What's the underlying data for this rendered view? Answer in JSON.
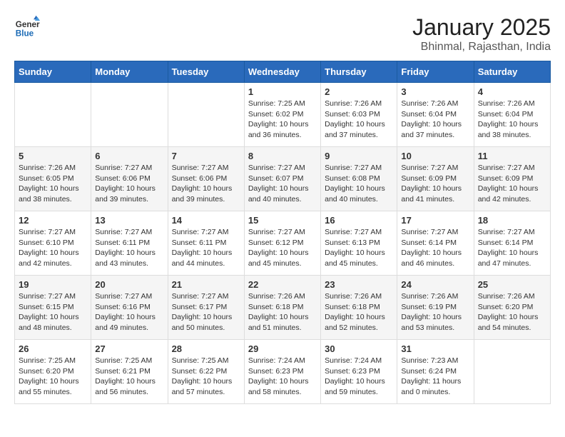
{
  "header": {
    "logo_line1": "General",
    "logo_line2": "Blue",
    "month_title": "January 2025",
    "location": "Bhinmal, Rajasthan, India"
  },
  "weekdays": [
    "Sunday",
    "Monday",
    "Tuesday",
    "Wednesday",
    "Thursday",
    "Friday",
    "Saturday"
  ],
  "weeks": [
    [
      {
        "day": "",
        "info": ""
      },
      {
        "day": "",
        "info": ""
      },
      {
        "day": "",
        "info": ""
      },
      {
        "day": "1",
        "info": "Sunrise: 7:25 AM\nSunset: 6:02 PM\nDaylight: 10 hours and 36 minutes."
      },
      {
        "day": "2",
        "info": "Sunrise: 7:26 AM\nSunset: 6:03 PM\nDaylight: 10 hours and 37 minutes."
      },
      {
        "day": "3",
        "info": "Sunrise: 7:26 AM\nSunset: 6:04 PM\nDaylight: 10 hours and 37 minutes."
      },
      {
        "day": "4",
        "info": "Sunrise: 7:26 AM\nSunset: 6:04 PM\nDaylight: 10 hours and 38 minutes."
      }
    ],
    [
      {
        "day": "5",
        "info": "Sunrise: 7:26 AM\nSunset: 6:05 PM\nDaylight: 10 hours and 38 minutes."
      },
      {
        "day": "6",
        "info": "Sunrise: 7:27 AM\nSunset: 6:06 PM\nDaylight: 10 hours and 39 minutes."
      },
      {
        "day": "7",
        "info": "Sunrise: 7:27 AM\nSunset: 6:06 PM\nDaylight: 10 hours and 39 minutes."
      },
      {
        "day": "8",
        "info": "Sunrise: 7:27 AM\nSunset: 6:07 PM\nDaylight: 10 hours and 40 minutes."
      },
      {
        "day": "9",
        "info": "Sunrise: 7:27 AM\nSunset: 6:08 PM\nDaylight: 10 hours and 40 minutes."
      },
      {
        "day": "10",
        "info": "Sunrise: 7:27 AM\nSunset: 6:09 PM\nDaylight: 10 hours and 41 minutes."
      },
      {
        "day": "11",
        "info": "Sunrise: 7:27 AM\nSunset: 6:09 PM\nDaylight: 10 hours and 42 minutes."
      }
    ],
    [
      {
        "day": "12",
        "info": "Sunrise: 7:27 AM\nSunset: 6:10 PM\nDaylight: 10 hours and 42 minutes."
      },
      {
        "day": "13",
        "info": "Sunrise: 7:27 AM\nSunset: 6:11 PM\nDaylight: 10 hours and 43 minutes."
      },
      {
        "day": "14",
        "info": "Sunrise: 7:27 AM\nSunset: 6:11 PM\nDaylight: 10 hours and 44 minutes."
      },
      {
        "day": "15",
        "info": "Sunrise: 7:27 AM\nSunset: 6:12 PM\nDaylight: 10 hours and 45 minutes."
      },
      {
        "day": "16",
        "info": "Sunrise: 7:27 AM\nSunset: 6:13 PM\nDaylight: 10 hours and 45 minutes."
      },
      {
        "day": "17",
        "info": "Sunrise: 7:27 AM\nSunset: 6:14 PM\nDaylight: 10 hours and 46 minutes."
      },
      {
        "day": "18",
        "info": "Sunrise: 7:27 AM\nSunset: 6:14 PM\nDaylight: 10 hours and 47 minutes."
      }
    ],
    [
      {
        "day": "19",
        "info": "Sunrise: 7:27 AM\nSunset: 6:15 PM\nDaylight: 10 hours and 48 minutes."
      },
      {
        "day": "20",
        "info": "Sunrise: 7:27 AM\nSunset: 6:16 PM\nDaylight: 10 hours and 49 minutes."
      },
      {
        "day": "21",
        "info": "Sunrise: 7:27 AM\nSunset: 6:17 PM\nDaylight: 10 hours and 50 minutes."
      },
      {
        "day": "22",
        "info": "Sunrise: 7:26 AM\nSunset: 6:18 PM\nDaylight: 10 hours and 51 minutes."
      },
      {
        "day": "23",
        "info": "Sunrise: 7:26 AM\nSunset: 6:18 PM\nDaylight: 10 hours and 52 minutes."
      },
      {
        "day": "24",
        "info": "Sunrise: 7:26 AM\nSunset: 6:19 PM\nDaylight: 10 hours and 53 minutes."
      },
      {
        "day": "25",
        "info": "Sunrise: 7:26 AM\nSunset: 6:20 PM\nDaylight: 10 hours and 54 minutes."
      }
    ],
    [
      {
        "day": "26",
        "info": "Sunrise: 7:25 AM\nSunset: 6:20 PM\nDaylight: 10 hours and 55 minutes."
      },
      {
        "day": "27",
        "info": "Sunrise: 7:25 AM\nSunset: 6:21 PM\nDaylight: 10 hours and 56 minutes."
      },
      {
        "day": "28",
        "info": "Sunrise: 7:25 AM\nSunset: 6:22 PM\nDaylight: 10 hours and 57 minutes."
      },
      {
        "day": "29",
        "info": "Sunrise: 7:24 AM\nSunset: 6:23 PM\nDaylight: 10 hours and 58 minutes."
      },
      {
        "day": "30",
        "info": "Sunrise: 7:24 AM\nSunset: 6:23 PM\nDaylight: 10 hours and 59 minutes."
      },
      {
        "day": "31",
        "info": "Sunrise: 7:23 AM\nSunset: 6:24 PM\nDaylight: 11 hours and 0 minutes."
      },
      {
        "day": "",
        "info": ""
      }
    ]
  ]
}
